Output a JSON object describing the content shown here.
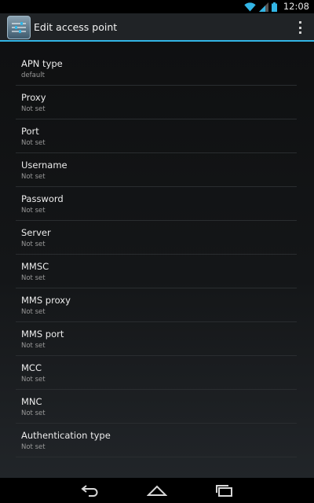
{
  "status_bar": {
    "time": "12:08",
    "icons": [
      "wifi-icon",
      "signal-icon",
      "battery-icon"
    ],
    "accent": "#33b5e5"
  },
  "action_bar": {
    "title": "Edit access point",
    "icon": "settings-sliders-icon",
    "overflow_icon": "overflow-menu-icon",
    "accent": "#33b5e5"
  },
  "settings": [
    {
      "title": "APN type",
      "value": "default"
    },
    {
      "title": "Proxy",
      "value": "Not set"
    },
    {
      "title": "Port",
      "value": "Not set"
    },
    {
      "title": "Username",
      "value": "Not set"
    },
    {
      "title": "Password",
      "value": "Not set"
    },
    {
      "title": "Server",
      "value": "Not set"
    },
    {
      "title": "MMSC",
      "value": "Not set"
    },
    {
      "title": "MMS proxy",
      "value": "Not set"
    },
    {
      "title": "MMS port",
      "value": "Not set"
    },
    {
      "title": "MCC",
      "value": "Not set"
    },
    {
      "title": "MNC",
      "value": "Not set"
    },
    {
      "title": "Authentication type",
      "value": "Not set"
    }
  ],
  "nav_bar": {
    "icons": [
      "back-icon",
      "home-icon",
      "recent-apps-icon"
    ]
  }
}
